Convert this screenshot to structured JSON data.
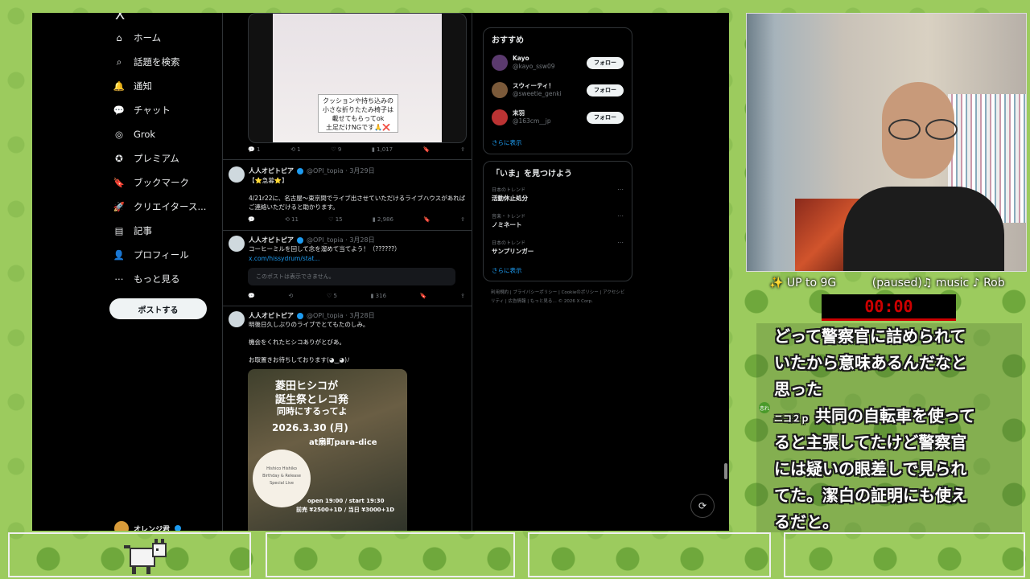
{
  "sidebar": {
    "logo": "X",
    "items": [
      {
        "label": "ホーム",
        "icon": "home-icon",
        "glyph": "⌂"
      },
      {
        "label": "話題を検索",
        "icon": "search-icon",
        "glyph": "⌕"
      },
      {
        "label": "通知",
        "icon": "bell-icon",
        "glyph": "🔔"
      },
      {
        "label": "チャット",
        "icon": "chat-icon",
        "glyph": "💬"
      },
      {
        "label": "Grok",
        "icon": "grok-icon",
        "glyph": "◎"
      },
      {
        "label": "プレミアム",
        "icon": "premium-icon",
        "glyph": "✪"
      },
      {
        "label": "ブックマーク",
        "icon": "bookmark-icon",
        "glyph": "🔖"
      },
      {
        "label": "クリエイタース...",
        "icon": "rocket-icon",
        "glyph": "🚀"
      },
      {
        "label": "記事",
        "icon": "article-icon",
        "glyph": "▤"
      },
      {
        "label": "プロフィール",
        "icon": "profile-icon",
        "glyph": "👤"
      },
      {
        "label": "もっと見る",
        "icon": "more-icon",
        "glyph": "⋯"
      }
    ],
    "post_button": "ポストする",
    "account_name": "オレンジ君"
  },
  "timeline": {
    "top_caption": "クッションや持ち込みの\n小さな折りたたみ椅子は\n載せてもらってok\n土足だけNGです🙏❌",
    "top_actions": {
      "reply": "1",
      "retweet": "1",
      "like": "9",
      "views": "1,017"
    },
    "tweets": [
      {
        "name": "人人オピトピア",
        "handle": "@OPI_topia · 3月29日",
        "text": "【⭐急募⭐】\n\n4/21r22に、名古屋〜東京間でライブ出させていただけるライブハウスがあればご連絡いただけると助かります。",
        "actions": {
          "reply": "",
          "retweet": "11",
          "like": "15",
          "views": "2,986"
        }
      },
      {
        "name": "人人オピトピア",
        "handle": "@OPI_topia · 3月28日",
        "text": "コーヒーミルを回して念を溜めて当てよう！（??????）",
        "link": "x.com/hissydrum/stat...",
        "hidden_notice": "このポストは表示できません。",
        "actions": {
          "reply": "",
          "retweet": "",
          "like": "5",
          "views": "316"
        }
      },
      {
        "name": "人人オピトピア",
        "handle": "@OPI_topia · 3月28日",
        "text": "明後日久しぶりのライブでとてもたのしみ。\n\n機会をくれたヒシコありがとびあ。\n\nお取置きお待ちしております(◕‿◕)ﾉ",
        "poster": {
          "line1": "菱田ヒシコが",
          "line2": "誕生祭とレコ発",
          "line3": "同時にするってよ",
          "date": "2026.3.30 (月)",
          "venue": "at扇町para-dice",
          "badge": "Hishico Hishiko\nBirthday & Release\nSpecial Live",
          "time": "open 19:00 / start 19:30",
          "price": "前売 ¥2500+1D / 当日 ¥3000+1D"
        }
      }
    ]
  },
  "right_panel": {
    "recommend_title": "おすすめ",
    "recommend": [
      {
        "name": "Kayo",
        "handle": "@kayo_ssw09",
        "button": "フォロー",
        "color": "#5b3a6e"
      },
      {
        "name": "スウィーティ！",
        "handle": "@sweetie_genki",
        "button": "フォロー",
        "color": "#7b5a3a"
      },
      {
        "name": "末羽",
        "handle": "@163cm__jp",
        "button": "フォロー",
        "color": "#b33"
      }
    ],
    "show_more": "さらに表示",
    "trends_title": "「いま」を見つけよう",
    "trends": [
      {
        "category": "日本のトレンド",
        "name": "活動休止処分"
      },
      {
        "category": "音楽・トレンド",
        "name": "ノミネート"
      },
      {
        "category": "日本のトレンド",
        "name": "サンプリンガー"
      }
    ],
    "trends_more": "さらに表示",
    "footer": "利用規約 | プライバシーポリシー | Cookieのポリシー | アクセシビリティ | 広告情報 | もっと見る… © 2026 X Corp."
  },
  "stream": {
    "ticker": "✨ UP to 9G          (paused)♫ music ♪ Rob",
    "timer": "00:00",
    "chat": [
      "どって警察官に詰められて",
      "いたから意味あるんだなと",
      "思った",
      "共同の自転車を使って",
      "ると主張してたけど警察官",
      "には疑いの眼差しで見られ",
      "てた。潔白の証明にも使え",
      "るだと。"
    ],
    "chat_user": "ニコ２ｐ",
    "chat_icon_label": "恋れ"
  },
  "colors": {
    "accent": "#1d9bf0",
    "background": "#000000",
    "stream_bg": "#9ccb5e"
  }
}
